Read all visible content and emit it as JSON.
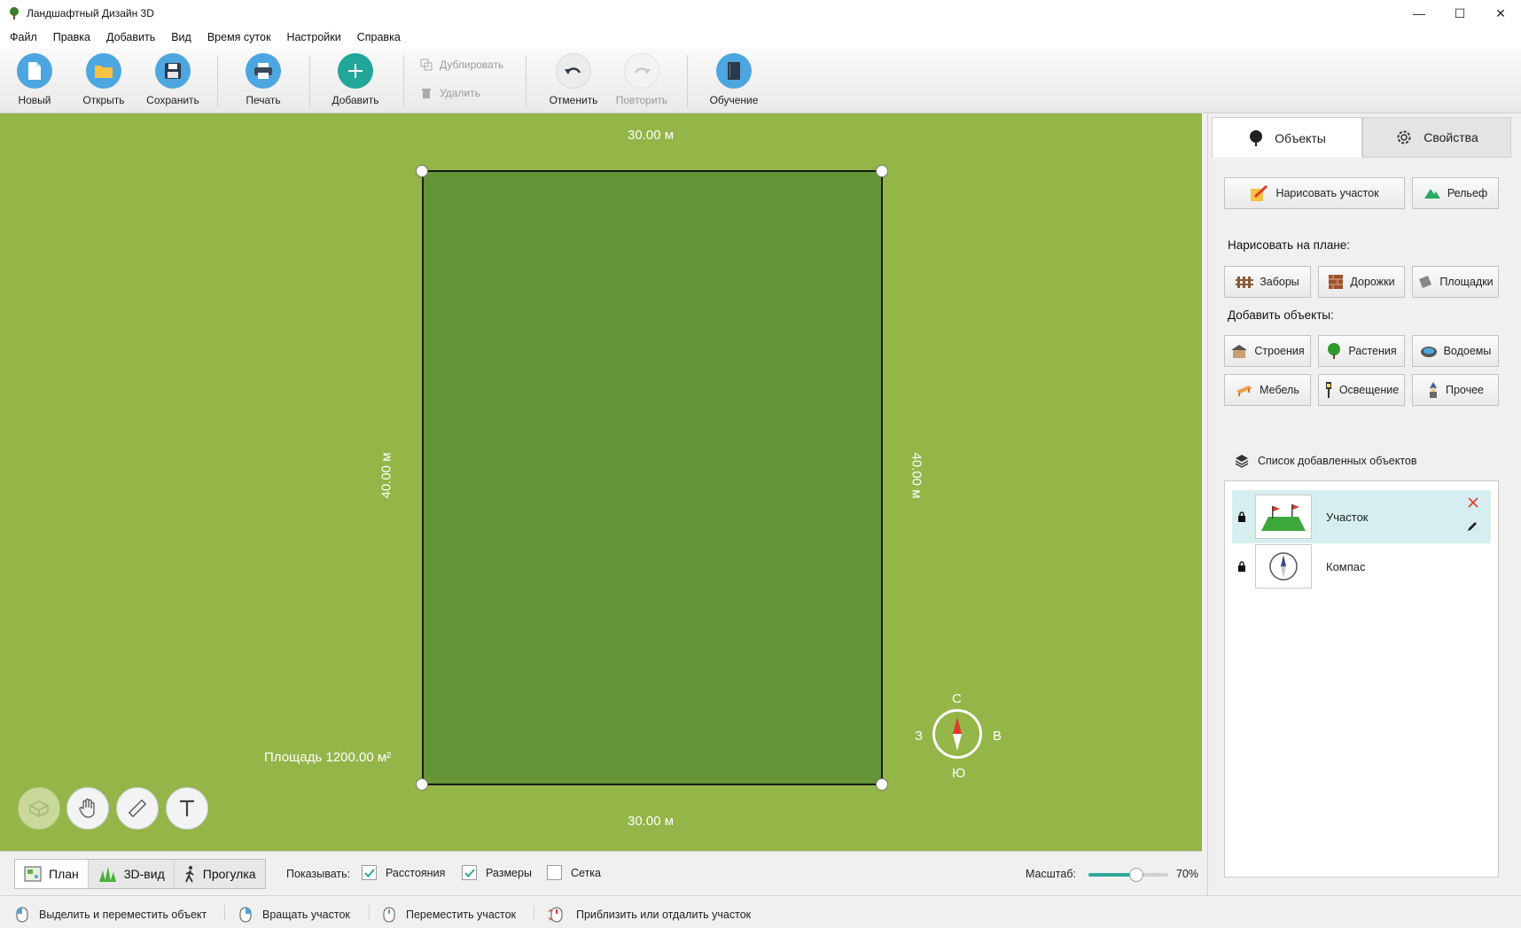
{
  "window": {
    "title": "Ландшафтный Дизайн 3D",
    "minimize": "—",
    "maximize": "☐",
    "close": "✕"
  },
  "menu": [
    "Файл",
    "Правка",
    "Добавить",
    "Вид",
    "Время суток",
    "Настройки",
    "Справка"
  ],
  "toolbar": {
    "new": "Новый",
    "open": "Открыть",
    "save": "Сохранить",
    "print": "Печать",
    "add": "Добавить",
    "duplicate": "Дублировать",
    "delete": "Удалить",
    "undo": "Отменить",
    "redo": "Повторить",
    "tutorial": "Обучение"
  },
  "canvas": {
    "top_dim": "30.00 м",
    "bottom_dim": "30.00 м",
    "left_dim": "40.00 м",
    "right_dim": "40.00 м",
    "area": "Площадь 1200.00  м²",
    "compass": {
      "n": "С",
      "s": "Ю",
      "w": "З",
      "e": "В"
    }
  },
  "view_tabs": {
    "plan": "План",
    "view3d": "3D-вид",
    "walk": "Прогулка"
  },
  "show": {
    "label": "Показывать:",
    "distances": "Расстояния",
    "distances_checked": true,
    "sizes": "Размеры",
    "sizes_checked": true,
    "grid": "Сетка",
    "grid_checked": false
  },
  "scale": {
    "label": "Масштаб:",
    "value": "70%",
    "level": 0.6
  },
  "status": {
    "select": "Выделить и переместить объект",
    "rotate": "Вращать участок",
    "move": "Переместить участок",
    "zoom": "Приблизить или отдалить участок"
  },
  "panel": {
    "tab_objects": "Объекты",
    "tab_properties": "Свойства",
    "draw_plot": "Нарисовать участок",
    "relief": "Рельеф",
    "draw_on_plan": "Нарисовать на плане:",
    "fences": "Заборы",
    "paths": "Дорожки",
    "areas": "Площадки",
    "add_objects": "Добавить объекты:",
    "buildings": "Строения",
    "plants": "Растения",
    "ponds": "Водоемы",
    "furniture": "Мебель",
    "lighting": "Освещение",
    "other": "Прочее",
    "list_title": "Список добавленных объектов",
    "items": [
      {
        "name": "Участок"
      },
      {
        "name": "Компас"
      }
    ]
  },
  "colors": {
    "lawn": "#94b548",
    "plot": "#659537",
    "accent": "#2aa89a",
    "selected_row": "#d7eef0"
  }
}
